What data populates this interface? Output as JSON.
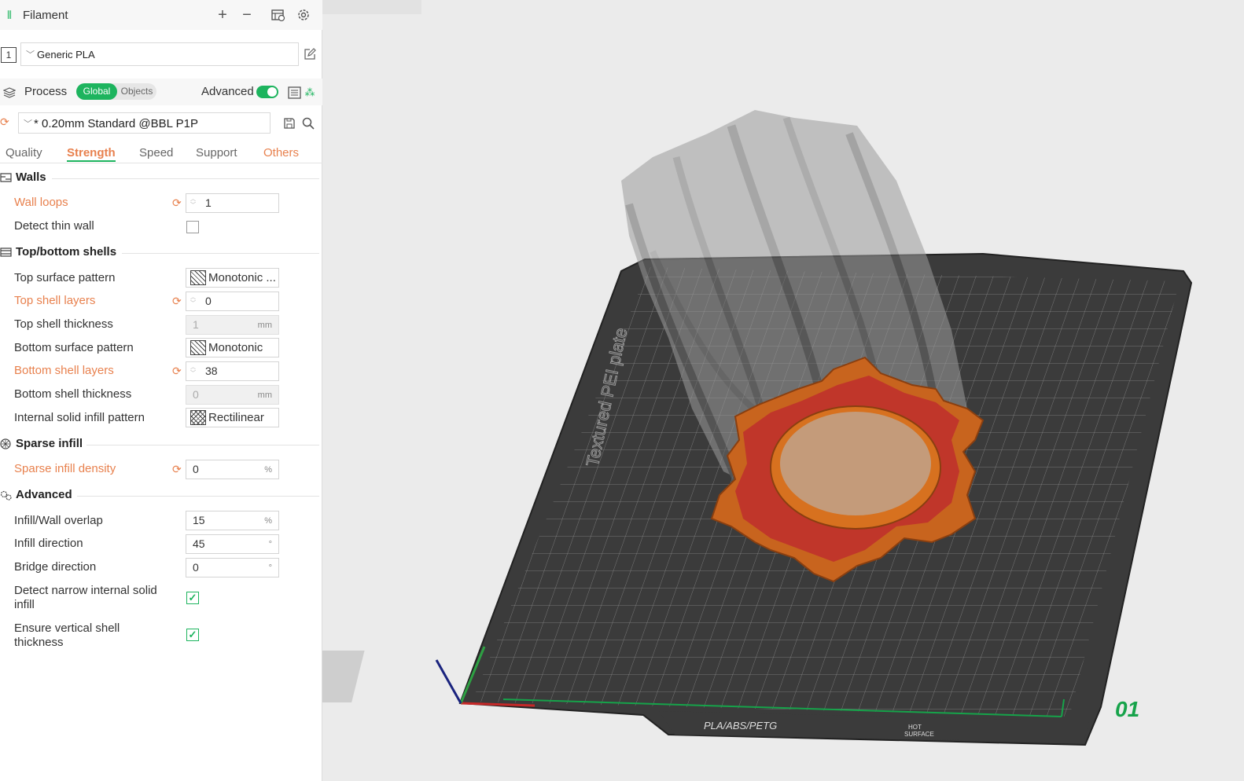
{
  "filament": {
    "title": "Filament",
    "slot": "1",
    "preset": "Generic PLA"
  },
  "process": {
    "title": "Process",
    "toggle_global": "Global",
    "toggle_objects": "Objects",
    "advanced_label": "Advanced",
    "advanced_on": true,
    "preset": "* 0.20mm Standard @BBL P1P"
  },
  "tabs": [
    "Quality",
    "Strength",
    "Speed",
    "Support",
    "Others"
  ],
  "active_tab": "Strength",
  "sections": {
    "walls": "Walls",
    "top_bottom": "Top/bottom shells",
    "sparse": "Sparse infill",
    "advanced": "Advanced"
  },
  "settings": {
    "wall_loops": {
      "label": "Wall loops",
      "value": "1"
    },
    "detect_thin_wall": {
      "label": "Detect thin wall",
      "checked": false
    },
    "top_surface_pattern": {
      "label": "Top surface pattern",
      "value": "Monotonic ..."
    },
    "top_shell_layers": {
      "label": "Top shell layers",
      "value": "0"
    },
    "top_shell_thickness": {
      "label": "Top shell thickness",
      "value": "1",
      "unit": "mm"
    },
    "bottom_surface_pattern": {
      "label": "Bottom surface pattern",
      "value": "Monotonic"
    },
    "bottom_shell_layers": {
      "label": "Bottom shell layers",
      "value": "38"
    },
    "bottom_shell_thickness": {
      "label": "Bottom shell thickness",
      "value": "0",
      "unit": "mm"
    },
    "internal_solid_infill_pattern": {
      "label": "Internal solid infill pattern",
      "value": "Rectilinear"
    },
    "sparse_infill_density": {
      "label": "Sparse infill density",
      "value": "0",
      "unit": "%"
    },
    "infill_wall_overlap": {
      "label": "Infill/Wall overlap",
      "value": "15",
      "unit": "%"
    },
    "infill_direction": {
      "label": "Infill direction",
      "value": "45",
      "unit": "°"
    },
    "bridge_direction": {
      "label": "Bridge direction",
      "value": "0",
      "unit": "°"
    },
    "detect_narrow_line1": "Detect narrow internal solid",
    "detect_narrow_line2": "infill",
    "detect_narrow_checked": true,
    "ensure_vertical_line1": "Ensure vertical shell",
    "ensure_vertical_line2": "thickness",
    "ensure_vertical_checked": true
  },
  "plate": {
    "label": "Textured PEI plate",
    "number": "01",
    "brand_text": "PLA/ABS/PETG",
    "hot_text1": "HOT",
    "hot_text2": "SURFACE"
  },
  "colors": {
    "accent_green": "#1db45e",
    "modified_orange": "#e8814e",
    "model_orange": "#c8641e",
    "model_red": "#c0362a",
    "bed_dark": "#3b3b3b"
  }
}
